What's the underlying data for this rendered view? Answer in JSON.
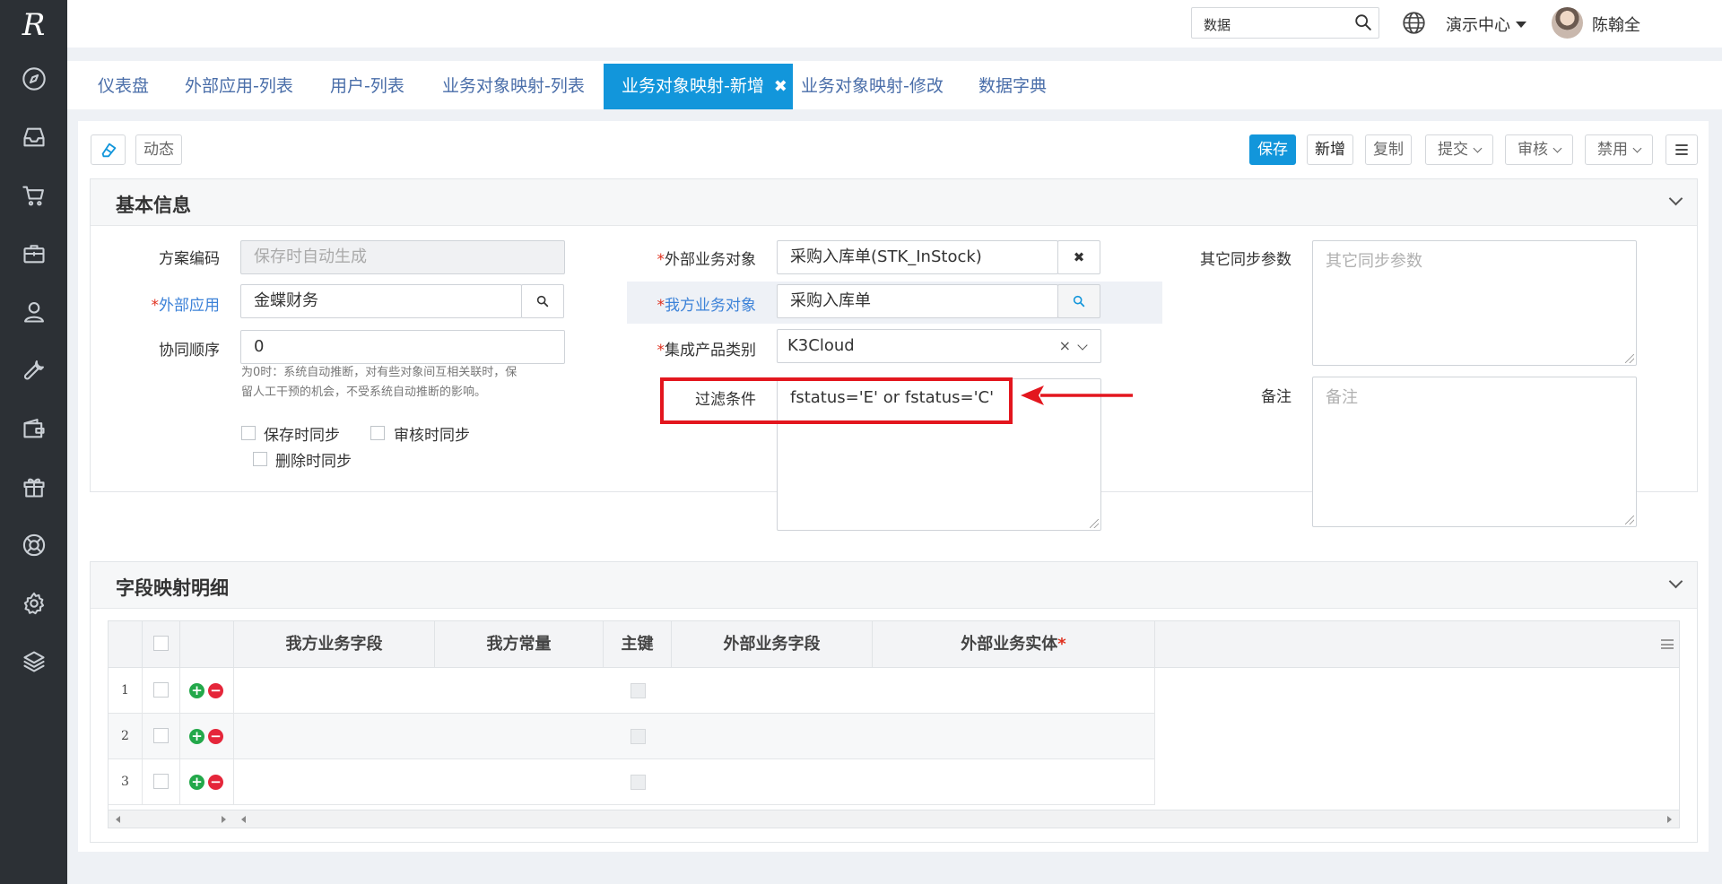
{
  "sidebar": {
    "logo": "R",
    "items": [
      {
        "icon": "compass-icon"
      },
      {
        "icon": "inbox-icon"
      },
      {
        "icon": "cart-icon"
      },
      {
        "icon": "briefcase-icon"
      },
      {
        "icon": "user-icon"
      },
      {
        "icon": "wrench-icon"
      },
      {
        "icon": "wallet-icon"
      },
      {
        "icon": "gift-icon"
      },
      {
        "icon": "lifebuoy-icon"
      },
      {
        "icon": "gear-icon"
      },
      {
        "icon": "layers-icon"
      }
    ]
  },
  "header": {
    "search_value": "数据",
    "org_label": "演示中心",
    "user_name": "陈翰全",
    "help_glyph": "?"
  },
  "tabs": [
    {
      "label": "仪表盘"
    },
    {
      "label": "外部应用-列表"
    },
    {
      "label": "用户-列表"
    },
    {
      "label": "业务对象映射-列表"
    },
    {
      "label": "业务对象映射-新增",
      "active": true
    },
    {
      "label": "业务对象映射-修改"
    },
    {
      "label": "数据字典"
    }
  ],
  "toolbar": {
    "dynamic_label": "动态",
    "save_label": "保存",
    "new_label": "新增",
    "copy_label": "复制",
    "submit_label": "提交",
    "audit_label": "审核",
    "disable_label": "禁用"
  },
  "basic": {
    "title": "基本信息",
    "scheme_code_label": "方案编码",
    "scheme_code_placeholder": "保存时自动生成",
    "ext_app_label": "外部应用",
    "ext_app_value": "金蝶财务",
    "sync_order_label": "协同顺序",
    "sync_order_value": "0",
    "sync_order_hint_1": "为0时：系统自动推断，对有些对象间互相关联时，保",
    "sync_order_hint_2": "留人工干预的机会，不受系统自动推断的影响。",
    "sync_on_save": "保存时同步",
    "sync_on_audit": "审核时同步",
    "sync_on_delete": "删除时同步",
    "ext_obj_label": "外部业务对象",
    "ext_obj_value": "采购入库单(STK_InStock)",
    "my_obj_label": "我方业务对象",
    "my_obj_value": "采购入库单",
    "product_type_label": "集成产品类别",
    "product_type_value": "K3Cloud",
    "filter_label": "过滤条件",
    "filter_value": "fstatus='E' or fstatus='C'",
    "other_params_label": "其它同步参数",
    "other_params_placeholder": "其它同步参数",
    "remark_label": "备注",
    "remark_placeholder": "备注",
    "required_mark": "*"
  },
  "fields": {
    "title": "字段映射明细",
    "columns": {
      "my_field": "我方业务字段",
      "my_const": "我方常量",
      "primary_key": "主键",
      "ext_field": "外部业务字段",
      "ext_entity": "外部业务实体"
    },
    "rows": [
      {
        "num": "1"
      },
      {
        "num": "2"
      },
      {
        "num": "3"
      }
    ],
    "add_glyph": "+",
    "del_glyph": "−"
  },
  "colors": {
    "accent": "#1296db",
    "sidebar": "#2c3035",
    "highlight": "#e3161e"
  }
}
